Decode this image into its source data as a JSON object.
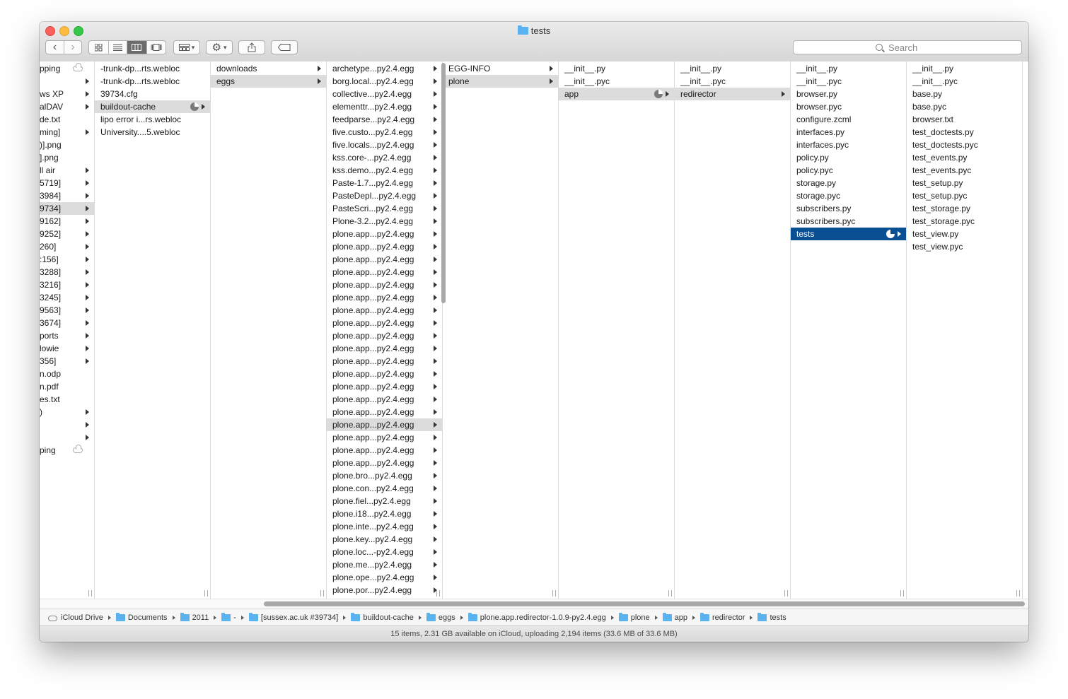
{
  "window": {
    "title": "tests"
  },
  "toolbar": {
    "back_label": "‹",
    "forward_label": "›",
    "view_icons": [
      "icon-view-icon",
      "list-view-icon",
      "column-view-icon",
      "cover-flow-view-icon"
    ],
    "active_view": "column-view",
    "search_placeholder": "Search"
  },
  "columns": [
    {
      "name": "col-0",
      "items": [
        {
          "label": "pping",
          "cloud": true
        },
        {
          "label": "",
          "arrow": true
        },
        {
          "label": "ws XP",
          "arrow": true
        },
        {
          "label": "alDAV",
          "arrow": true
        },
        {
          "label": "de.txt"
        },
        {
          "label": "ming]",
          "arrow": true
        },
        {
          "label": ")].png"
        },
        {
          "label": "].png"
        },
        {
          "label": "ll air",
          "arrow": true
        },
        {
          "label": "5719]",
          "arrow": true
        },
        {
          "label": "3984]",
          "arrow": true
        },
        {
          "label": "9734]",
          "arrow": true,
          "selected": true
        },
        {
          "label": "9162]",
          "arrow": true
        },
        {
          "label": "9252]",
          "arrow": true
        },
        {
          "label": "260]",
          "arrow": true
        },
        {
          "label": ":156]",
          "arrow": true
        },
        {
          "label": "3288]",
          "arrow": true
        },
        {
          "label": "3216]",
          "arrow": true
        },
        {
          "label": "3245]",
          "arrow": true
        },
        {
          "label": "9563]",
          "arrow": true
        },
        {
          "label": "3674]",
          "arrow": true
        },
        {
          "label": "ports",
          "arrow": true
        },
        {
          "label": "lowie",
          "arrow": true
        },
        {
          "label": "356]",
          "arrow": true
        },
        {
          "label": "n.odp"
        },
        {
          "label": "n.pdf"
        },
        {
          "label": "es.txt"
        },
        {
          "label": ")",
          "arrow": true
        },
        {
          "label": "",
          "arrow": true
        },
        {
          "label": "",
          "arrow": true
        },
        {
          "label": "ping",
          "cloud": true
        }
      ]
    },
    {
      "name": "col-1",
      "items": [
        {
          "label": "-trunk-dp...rts.webloc"
        },
        {
          "label": "-trunk-dp...rts.webloc"
        },
        {
          "label": "39734.cfg"
        },
        {
          "label": "buildout-cache",
          "arrow": true,
          "selected": true,
          "pie": true
        },
        {
          "label": "lipo error i...rs.webloc"
        },
        {
          "label": "University....5.webloc"
        }
      ]
    },
    {
      "name": "col-2",
      "items": [
        {
          "label": "downloads",
          "arrow": true
        },
        {
          "label": "eggs",
          "arrow": true,
          "selected": true
        }
      ]
    },
    {
      "name": "col-3",
      "items": [
        {
          "label": "archetype...py2.4.egg",
          "arrow": true
        },
        {
          "label": "borg.local...py2.4.egg",
          "arrow": true
        },
        {
          "label": "collective...py2.4.egg",
          "arrow": true
        },
        {
          "label": "elementtr...py2.4.egg",
          "arrow": true
        },
        {
          "label": "feedparse...py2.4.egg",
          "arrow": true
        },
        {
          "label": "five.custo...py2.4.egg",
          "arrow": true
        },
        {
          "label": "five.locals...py2.4.egg",
          "arrow": true
        },
        {
          "label": "kss.core-...py2.4.egg",
          "arrow": true
        },
        {
          "label": "kss.demo...py2.4.egg",
          "arrow": true
        },
        {
          "label": "Paste-1.7...py2.4.egg",
          "arrow": true
        },
        {
          "label": "PasteDepl...py2.4.egg",
          "arrow": true
        },
        {
          "label": "PasteScri...py2.4.egg",
          "arrow": true
        },
        {
          "label": "Plone-3.2...py2.4.egg",
          "arrow": true
        },
        {
          "label": "plone.app...py2.4.egg",
          "arrow": true
        },
        {
          "label": "plone.app...py2.4.egg",
          "arrow": true
        },
        {
          "label": "plone.app...py2.4.egg",
          "arrow": true
        },
        {
          "label": "plone.app...py2.4.egg",
          "arrow": true
        },
        {
          "label": "plone.app...py2.4.egg",
          "arrow": true
        },
        {
          "label": "plone.app...py2.4.egg",
          "arrow": true
        },
        {
          "label": "plone.app...py2.4.egg",
          "arrow": true
        },
        {
          "label": "plone.app...py2.4.egg",
          "arrow": true
        },
        {
          "label": "plone.app...py2.4.egg",
          "arrow": true
        },
        {
          "label": "plone.app...py2.4.egg",
          "arrow": true
        },
        {
          "label": "plone.app...py2.4.egg",
          "arrow": true
        },
        {
          "label": "plone.app...py2.4.egg",
          "arrow": true
        },
        {
          "label": "plone.app...py2.4.egg",
          "arrow": true
        },
        {
          "label": "plone.app...py2.4.egg",
          "arrow": true
        },
        {
          "label": "plone.app...py2.4.egg",
          "arrow": true
        },
        {
          "label": "plone.app...py2.4.egg",
          "arrow": true,
          "selected": true
        },
        {
          "label": "plone.app...py2.4.egg",
          "arrow": true
        },
        {
          "label": "plone.app...py2.4.egg",
          "arrow": true
        },
        {
          "label": "plone.app...py2.4.egg",
          "arrow": true
        },
        {
          "label": "plone.bro...py2.4.egg",
          "arrow": true
        },
        {
          "label": "plone.con...py2.4.egg",
          "arrow": true
        },
        {
          "label": "plone.fiel...py2.4.egg",
          "arrow": true
        },
        {
          "label": "plone.i18...py2.4.egg",
          "arrow": true
        },
        {
          "label": "plone.inte...py2.4.egg",
          "arrow": true
        },
        {
          "label": "plone.key...py2.4.egg",
          "arrow": true
        },
        {
          "label": "plone.loc...-py2.4.egg",
          "arrow": true
        },
        {
          "label": "plone.me...py2.4.egg",
          "arrow": true
        },
        {
          "label": "plone.ope...py2.4.egg",
          "arrow": true
        },
        {
          "label": "plone.por...py2.4.egg",
          "arrow": true
        },
        {
          "label": "plone.por...py2.4.egg",
          "arrow": true
        }
      ]
    },
    {
      "name": "col-4",
      "items": [
        {
          "label": "EGG-INFO",
          "arrow": true
        },
        {
          "label": "plone",
          "arrow": true,
          "selected": true
        }
      ]
    },
    {
      "name": "col-5",
      "items": [
        {
          "label": "__init__.py"
        },
        {
          "label": "__init__.pyc"
        },
        {
          "label": "app",
          "arrow": true,
          "selected": true,
          "pie": true
        }
      ]
    },
    {
      "name": "col-6",
      "items": [
        {
          "label": "__init__.py"
        },
        {
          "label": "__init__.pyc"
        },
        {
          "label": "redirector",
          "arrow": true,
          "selected": true
        }
      ]
    },
    {
      "name": "col-7",
      "items": [
        {
          "label": "__init__.py"
        },
        {
          "label": "__init__.pyc"
        },
        {
          "label": "browser.py"
        },
        {
          "label": "browser.pyc"
        },
        {
          "label": "configure.zcml"
        },
        {
          "label": "interfaces.py"
        },
        {
          "label": "interfaces.pyc"
        },
        {
          "label": "policy.py"
        },
        {
          "label": "policy.pyc"
        },
        {
          "label": "storage.py"
        },
        {
          "label": "storage.pyc"
        },
        {
          "label": "subscribers.py"
        },
        {
          "label": "subscribers.pyc"
        },
        {
          "label": "tests",
          "arrow": true,
          "active": true,
          "pie": true
        }
      ]
    },
    {
      "name": "col-8",
      "items": [
        {
          "label": "__init__.py"
        },
        {
          "label": "__init__.pyc"
        },
        {
          "label": "base.py"
        },
        {
          "label": "base.pyc"
        },
        {
          "label": "browser.txt"
        },
        {
          "label": "test_doctests.py"
        },
        {
          "label": "test_doctests.pyc"
        },
        {
          "label": "test_events.py"
        },
        {
          "label": "test_events.pyc"
        },
        {
          "label": "test_setup.py"
        },
        {
          "label": "test_setup.pyc"
        },
        {
          "label": "test_storage.py"
        },
        {
          "label": "test_storage.pyc"
        },
        {
          "label": "test_view.py"
        },
        {
          "label": "test_view.pyc"
        }
      ]
    }
  ],
  "pathbar": [
    {
      "label": "iCloud Drive",
      "icon": "icloud-icon"
    },
    {
      "label": "Documents",
      "icon": "folder-icon"
    },
    {
      "label": "2011",
      "icon": "folder-icon"
    },
    {
      "label": "-",
      "icon": "folder-icon"
    },
    {
      "label": "[sussex.ac.uk #39734]",
      "icon": "folder-icon"
    },
    {
      "label": "buildout-cache",
      "icon": "folder-icon"
    },
    {
      "label": "eggs",
      "icon": "folder-icon"
    },
    {
      "label": "plone.app.redirector-1.0.9-py2.4.egg",
      "icon": "folder-icon"
    },
    {
      "label": "plone",
      "icon": "folder-icon"
    },
    {
      "label": "app",
      "icon": "folder-icon"
    },
    {
      "label": "redirector",
      "icon": "folder-icon"
    },
    {
      "label": "tests",
      "icon": "folder-icon"
    }
  ],
  "status": {
    "text": "15 items, 2.31 GB available on iCloud, uploading 2,194 items (33.6 MB of 33.6 MB)"
  },
  "colors": {
    "selection_active": "#0b4f93",
    "selection_inactive": "#dcdcdc",
    "folder": "#5ab3ef"
  }
}
